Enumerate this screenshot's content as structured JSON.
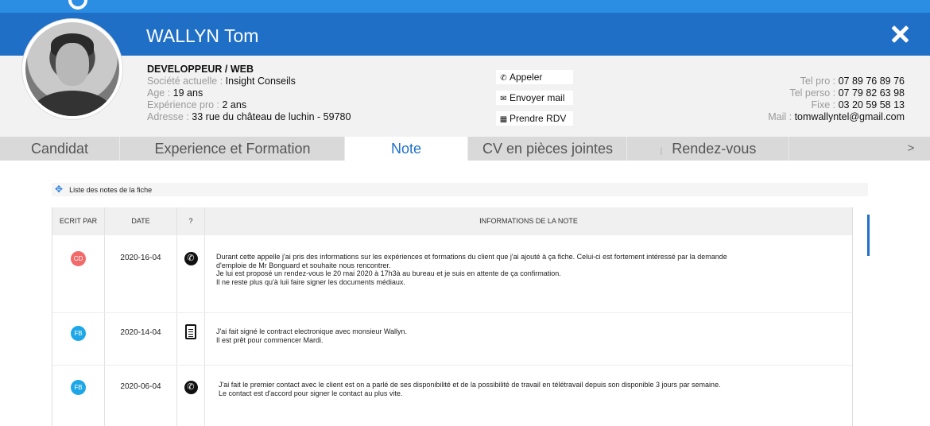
{
  "header": {
    "name": "WALLYN Tom"
  },
  "profile": {
    "job": "DEVELOPPEUR / WEB",
    "company_label": "Société actuelle : ",
    "company": "Insight Conseils",
    "age_label": "Age : ",
    "age": "19 ans",
    "experience_label": "Expérience pro : ",
    "experience": "2 ans",
    "address_label": "Adresse : ",
    "address": "33 rue du château de luchin - 59780"
  },
  "actions": {
    "call": "Appeler",
    "mail": "Envoyer mail",
    "rdv": "Prendre RDV"
  },
  "contacts": {
    "tel_pro_label": "Tel pro : ",
    "tel_pro": "07 89 76 89 76",
    "tel_perso_label": "Tel perso : ",
    "tel_perso": "07 79 82 63 98",
    "fixe_label": "Fixe : ",
    "fixe": "03 20 59 58 13",
    "mail_label": "Mail : ",
    "mail": "tomwallyntel@gmail.com"
  },
  "tabs": [
    {
      "label": "Candidat"
    },
    {
      "label": "Experience et Formation"
    },
    {
      "label": "Note"
    },
    {
      "label": "CV en pièces jointes"
    },
    {
      "label": "Rendez-vous"
    }
  ],
  "tab_more": ">",
  "notes_section": {
    "title": "Liste des notes de la fiche"
  },
  "table": {
    "headers": [
      "ECRIT PAR",
      "DATE",
      "?",
      "INFORMATIONS DE LA NOTE"
    ],
    "rows": [
      {
        "author": "CD",
        "author_color": "#f26a6a",
        "date": "2020-16-04",
        "type_icon": "phone-icon",
        "lines": [
          "Durant cette appelle j'ai pris des informations sur les expériences et formations du client que j'ai ajouté à ça fiche. Celui-ci est fortement intéressé par la demande",
          "d'emploie de Mr Bonguard et souhaite nous rencontrer.",
          "Je lui est proposé un rendez-vous le 20 mai 2020 à 17h3à au bureau et je suis en attente de ça confirmation.",
          "Il ne reste plus qu'à luii faire signer les documents médiaux."
        ]
      },
      {
        "author": "FB",
        "author_color": "#1ea7e8",
        "date": "2020-14-04",
        "type_icon": "document-icon",
        "lines": [
          "J'ai fait signé le contract electronique avec monsieur Wallyn.",
          "Il est prêt pour commencer Mardi."
        ]
      },
      {
        "author": "FB",
        "author_color": "#1ea7e8",
        "date": "2020-06-04",
        "type_icon": "phone-icon",
        "lines": [
          "J'ai fait le premier contact avec le client est on a parlé de ses disponibilité et de la possibilité de travail en télétravail depuis son disponible 3 jours par semaine.",
          "Le contact est d'accord pour signer le contact au plus vite."
        ]
      }
    ]
  }
}
